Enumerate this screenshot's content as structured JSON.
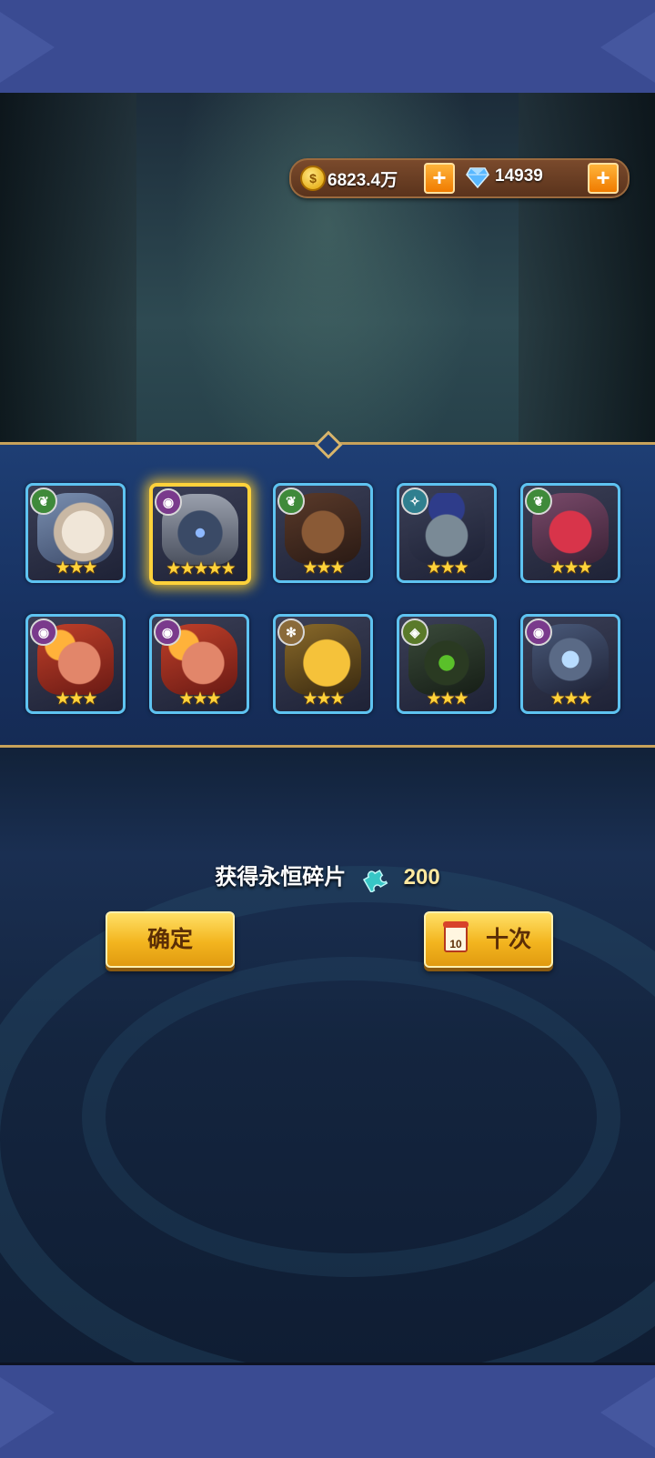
{
  "currency": {
    "gold": "6823.4万",
    "gems": "14939"
  },
  "heroes": [
    {
      "element": "nature",
      "stars": 3,
      "portrait": "eagle"
    },
    {
      "element": "dark",
      "stars": 5,
      "portrait": "armored-knight",
      "highlighted": true
    },
    {
      "element": "nature",
      "stars": 3,
      "portrait": "werewolf"
    },
    {
      "element": "water",
      "stars": 3,
      "portrait": "zombie"
    },
    {
      "element": "nature",
      "stars": 3,
      "portrait": "red-bird"
    },
    {
      "element": "dark",
      "stars": 3,
      "portrait": "flame-beast"
    },
    {
      "element": "dark",
      "stars": 3,
      "portrait": "flame-beast"
    },
    {
      "element": "light",
      "stars": 3,
      "portrait": "golden-golem"
    },
    {
      "element": "earth",
      "stars": 3,
      "portrait": "toxic-golem"
    },
    {
      "element": "dark",
      "stars": 3,
      "portrait": "ice-knight"
    }
  ],
  "reward": {
    "label": "获得永恒碎片",
    "amount": "200"
  },
  "buttons": {
    "confirm": "确定",
    "ten_pull": "十次",
    "ticket_count": "10"
  },
  "colors": {
    "nature": "#3f8a3a",
    "dark": "#7a3a8c",
    "water": "#2f7f8f",
    "light": "#8a6a3a",
    "earth": "#5a7a2a",
    "legend_frame": "#ffd23a",
    "normal_frame": "#5ec3f1"
  }
}
